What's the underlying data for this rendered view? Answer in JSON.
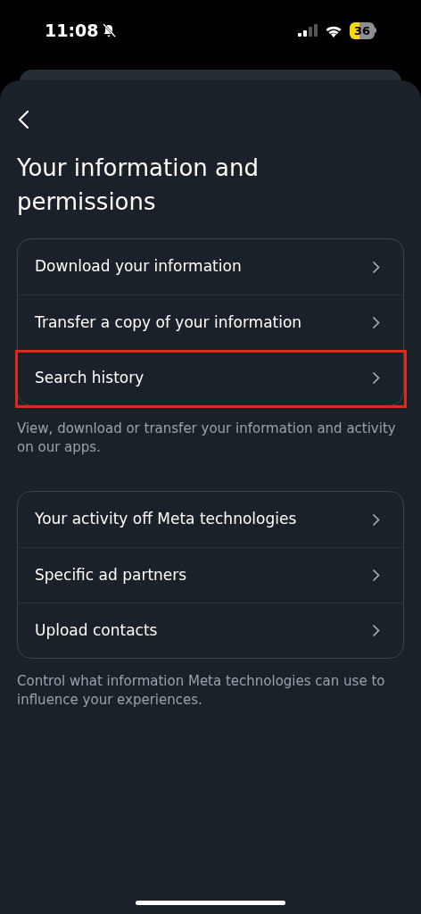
{
  "status_bar": {
    "time": "11:08",
    "silent": true,
    "battery": "36"
  },
  "title": "Your information and permissions",
  "groups": [
    {
      "items": [
        {
          "label": "Download your information",
          "highlighted": false
        },
        {
          "label": "Transfer a copy of your information",
          "highlighted": false
        },
        {
          "label": "Search history",
          "highlighted": true
        }
      ],
      "caption": "View, download or transfer your information and activity on our apps."
    },
    {
      "items": [
        {
          "label": "Your activity off Meta technologies",
          "highlighted": false
        },
        {
          "label": "Specific ad partners",
          "highlighted": false
        },
        {
          "label": "Upload contacts",
          "highlighted": false
        }
      ],
      "caption": "Control what information Meta technologies can use to influence your experiences."
    }
  ]
}
